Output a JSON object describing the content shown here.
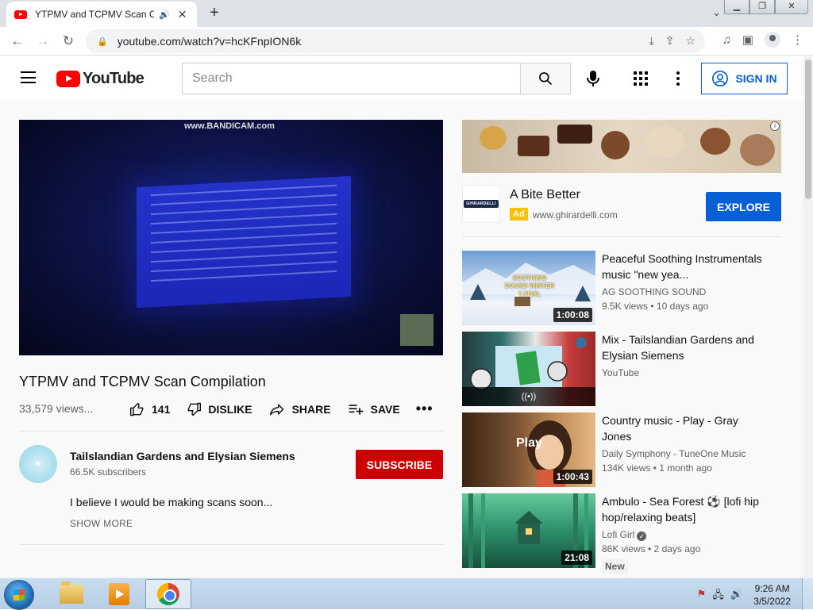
{
  "browser": {
    "tab_title": "YTPMV and TCPMV Scan Co",
    "url": "youtube.com/watch?v=hcKFnpION6k"
  },
  "header": {
    "logo_text": "YouTube",
    "search_placeholder": "Search",
    "sign_in_label": "SIGN IN"
  },
  "video": {
    "watermark": "www.BANDICAM.com",
    "title": "YTPMV and TCPMV Scan Compilation",
    "views": "33,579 views...",
    "likes": "141",
    "dislike_label": "DISLIKE",
    "share_label": "SHARE",
    "save_label": "SAVE"
  },
  "channel": {
    "name": "Tailslandian Gardens and Elysian Siemens",
    "subscribers": "66.5K subscribers",
    "subscribe_label": "SUBSCRIBE",
    "description": "I believe I would be making scans soon...",
    "show_more_label": "SHOW MORE"
  },
  "ad": {
    "logo_text": "GHIRARDELLI",
    "title": "A Bite Better",
    "badge": "Ad",
    "url": "www.ghirardelli.com",
    "cta_label": "EXPLORE"
  },
  "recommendations": [
    {
      "title": "Peaceful Soothing Instrumentals music \"new yea...",
      "channel": "AG SOOTHING SOUND",
      "meta": "9.5K views • 10 days ago",
      "duration": "1:00:08",
      "thumb_text": "SOOTHING SOUND WINTER CANAL",
      "thumb_colors": [
        "#7fa8d8",
        "#e8f0f8"
      ]
    },
    {
      "title": "Mix - Tailslandian Gardens and Elysian Siemens",
      "channel": "YouTube",
      "meta": "",
      "duration": "",
      "thumb_text": "",
      "thumb_colors": [
        "#2f7f7a",
        "#b73131"
      ]
    },
    {
      "title": "Country music - Play - Gray Jones",
      "channel": "Daily Symphony - TuneOne Music",
      "meta": "134K views • 1 month ago",
      "duration": "1:00:43",
      "thumb_text": "Play",
      "thumb_colors": [
        "#6b4a2c",
        "#d8a36a"
      ]
    },
    {
      "title": "Ambulo - Sea Forest ⚽ [lofi hip hop/relaxing beats]",
      "channel": "Lofi Girl",
      "meta": "86K views • 2 days ago",
      "duration": "21:08",
      "badge": "New",
      "thumb_text": "",
      "thumb_colors": [
        "#1f6b4f",
        "#5fc28f"
      ]
    }
  ],
  "taskbar": {
    "time": "9:26 AM",
    "date": "3/5/2022"
  }
}
